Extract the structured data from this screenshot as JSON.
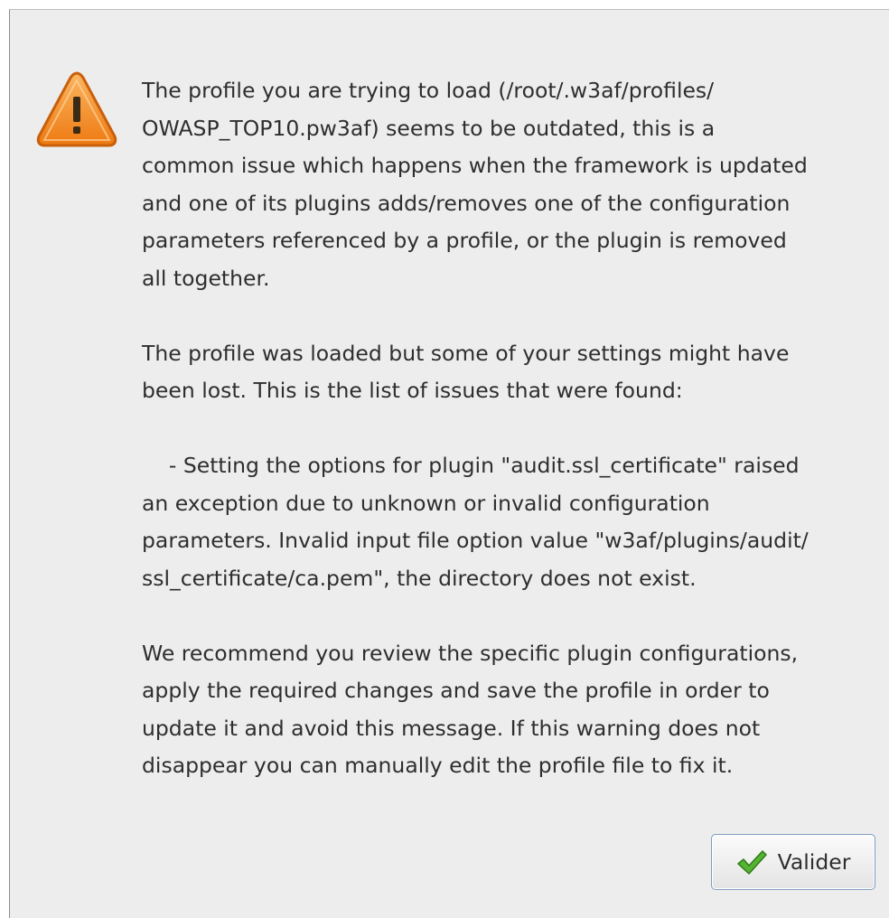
{
  "dialog": {
    "icon": "warning-icon",
    "message": "The profile you are trying to load (/root/.w3af/profiles/\nOWASP_TOP10.pw3af) seems to be outdated, this is a\ncommon issue which happens when the framework is updated\nand one of its plugins adds/removes one of the configuration\nparameters referenced by a profile, or the plugin is removed\nall together.\n\nThe profile was loaded but some of your settings might have\nbeen lost. This is the list of issues that were found:\n\n    - Setting the options for plugin \"audit.ssl_certificate\" raised\nan exception due to unknown or invalid configuration\nparameters. Invalid input file option value \"w3af/plugins/audit/\nssl_certificate/ca.pem\", the directory does not exist.\n\nWe recommend you review the specific plugin configurations,\napply the required changes and save the profile in order to\nupdate it and avoid this message. If this warning does not\ndisappear you can manually edit the profile file to fix it.",
    "ok_button": {
      "label": "Valider",
      "icon": "checkmark-icon"
    }
  },
  "colors": {
    "background": "#ededed",
    "text": "#2e2e2e",
    "warning": "#f08a1c",
    "check": "#4caf2a"
  }
}
